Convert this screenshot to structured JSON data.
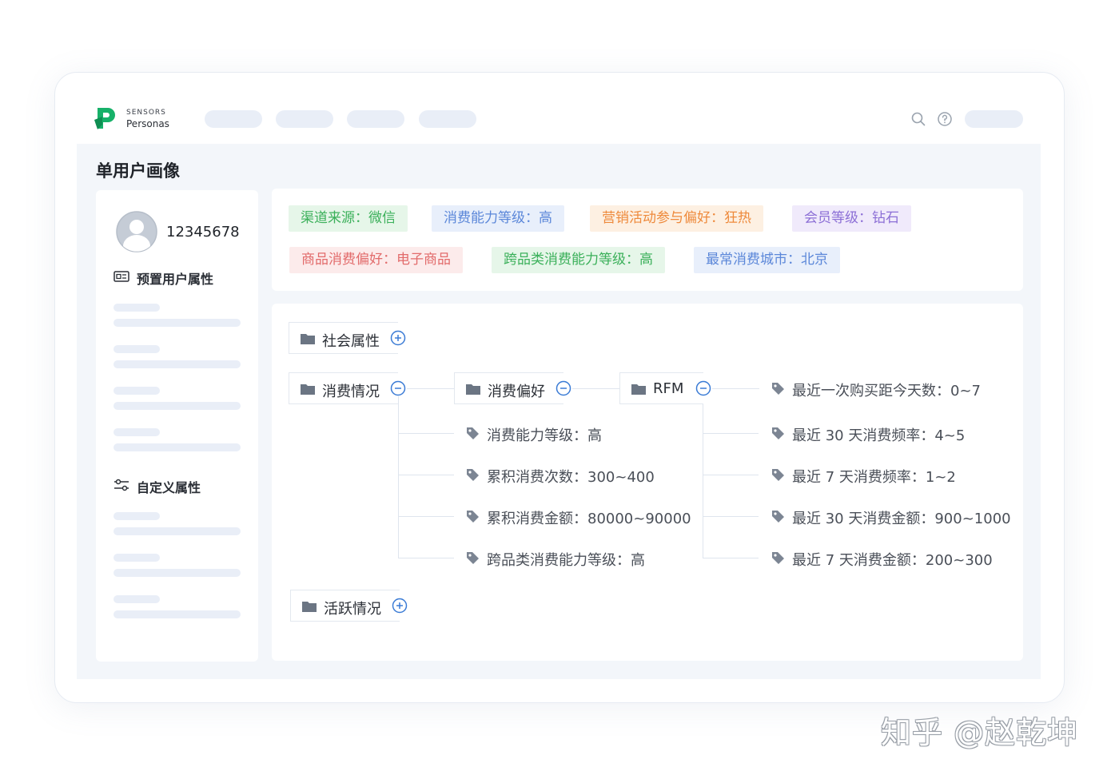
{
  "app": {
    "brand_top": "SENSORS",
    "brand_bottom": "Personas",
    "accent": "#17b169"
  },
  "header": {
    "icons": [
      "search-icon",
      "help-icon"
    ]
  },
  "page": {
    "title": "单用户画像"
  },
  "user": {
    "id": "12345678",
    "preset_section": "预置用户属性",
    "custom_section": "自定义属性"
  },
  "tags": [
    {
      "text": "渠道来源：微信",
      "color": "#3bb05a",
      "bg": "#e6f6e9"
    },
    {
      "text": "消费能力等级：高",
      "color": "#5b87d9",
      "bg": "#e8effb"
    },
    {
      "text": "营销活动参与偏好：狂热",
      "color": "#ee8a3c",
      "bg": "#fdf0e2"
    },
    {
      "text": "会员等级：钻石",
      "color": "#8c6fd6",
      "bg": "#f0eafb"
    },
    {
      "text": "商品消费偏好：电子商品",
      "color": "#e26b6b",
      "bg": "#fcebeb"
    },
    {
      "text": "跨品类消费能力等级：高",
      "color": "#3bb05a",
      "bg": "#e6f6e9"
    },
    {
      "text": "最常消费城市：北京",
      "color": "#5b87d9",
      "bg": "#e8effb"
    }
  ],
  "tree": {
    "social": "社会属性",
    "consumption": "消费情况",
    "preference": "消费偏好",
    "rfm": "RFM",
    "activity": "活跃情况",
    "preference_leaves": [
      "消费能力等级：高",
      "累积消费次数：300~400",
      "累积消费金额：80000~90000",
      "跨品类消费能力等级：高"
    ],
    "rfm_leaves": [
      "最近一次购买距今天数：0~7",
      "最近 30 天消费频率：4~5",
      "最近 7 天消费频率：1~2",
      "最近 30 天消费金额：900~1000",
      "最近 7 天消费金额：200~300"
    ]
  },
  "watermark": "知乎 @赵乾坤"
}
